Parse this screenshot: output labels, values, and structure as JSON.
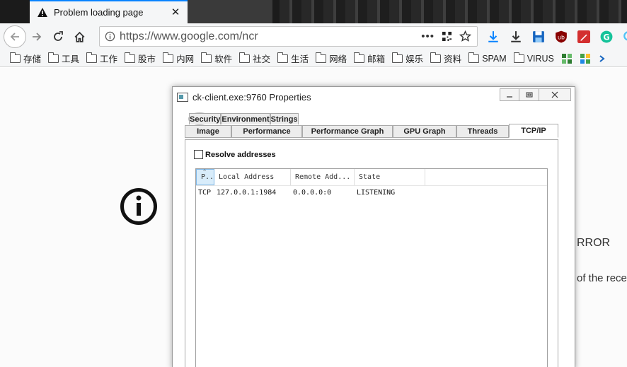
{
  "browser": {
    "tab_title": "Problem loading page",
    "url": "https://www.google.com/ncr",
    "bookmarks": [
      "存储",
      "工具",
      "工作",
      "股市",
      "内网",
      "软件",
      "社交",
      "生活",
      "网络",
      "邮箱",
      "娱乐",
      "资料",
      "SPAM",
      "VIRUS"
    ]
  },
  "page": {
    "peek_text_1": "RROR",
    "peek_text_2": "of the rece"
  },
  "dialog": {
    "title": "ck-client.exe:9760 Properties",
    "tabs_back": [
      "Security",
      "Environment",
      "Strings"
    ],
    "tabs_front": [
      "Image",
      "Performance",
      "Performance Graph",
      "GPU Graph",
      "Threads",
      "TCP/IP"
    ],
    "active_tab": "TCP/IP",
    "resolve_label": "Resolve addresses",
    "resolve_checked": false,
    "columns": [
      "P..",
      "Local Address",
      "Remote Add...",
      "State"
    ],
    "rows": [
      {
        "proto": "TCP",
        "local": "127.0.0.1:1984",
        "remote": "0.0.0.0:0",
        "state": "LISTENING"
      }
    ]
  }
}
